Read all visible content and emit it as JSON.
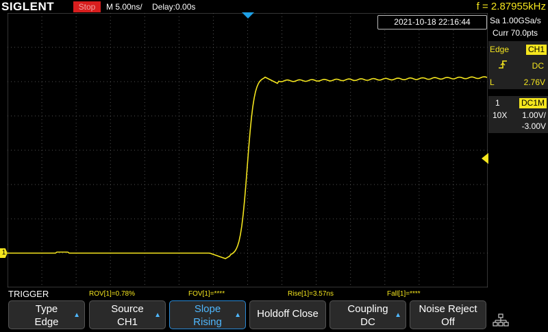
{
  "topbar": {
    "brand": "SIGLENT",
    "run_status": "Stop",
    "timebase": "M 5.00ns/",
    "delay": "Delay:0.00s",
    "frequency": "f = 2.87955kHz"
  },
  "datetime": "2021-10-18 22:16:44",
  "acquisition": {
    "sample_rate": "Sa 1.00GSa/s",
    "memory_depth": "Curr 70.0pts"
  },
  "trigger_panel": {
    "type": "Edge",
    "source": "CH1",
    "coupling": "DC",
    "level_label": "L",
    "level": "2.76V"
  },
  "channel_panel": {
    "number": "1",
    "coupling": "DC1M",
    "probe": "10X",
    "scale": "1.00V/",
    "offset": "-3.00V"
  },
  "markers": {
    "channel_marker": "1"
  },
  "measurements": {
    "section_title": "TRIGGER",
    "items": [
      {
        "label": "ROV[1]=0.78%"
      },
      {
        "label": "FOV[1]=****"
      },
      {
        "label": "Rise[1]=3.57ns"
      },
      {
        "label": "Fall[1]=****"
      }
    ]
  },
  "softkeys": [
    {
      "line1": "Type",
      "line2": "Edge"
    },
    {
      "line1": "Source",
      "line2": "CH1"
    },
    {
      "line1": "Slope",
      "line2": "Rising"
    },
    {
      "line1": "Holdoff Close",
      "line2": ""
    },
    {
      "line1": "Coupling",
      "line2": "DC"
    },
    {
      "line1": "Noise Reject",
      "line2": "Off"
    }
  ],
  "colors": {
    "trace": "#f5e61e",
    "trigger_marker": "#1ea0e6",
    "active_key": "#4fb8ff",
    "stop": "#d81e1e"
  },
  "waveform": {
    "type": "rising-edge step",
    "low_level_divisions": -0.1,
    "high_level_divisions": 6.05,
    "edge_start_ns": 0,
    "edge_end_ns": 4.5
  }
}
